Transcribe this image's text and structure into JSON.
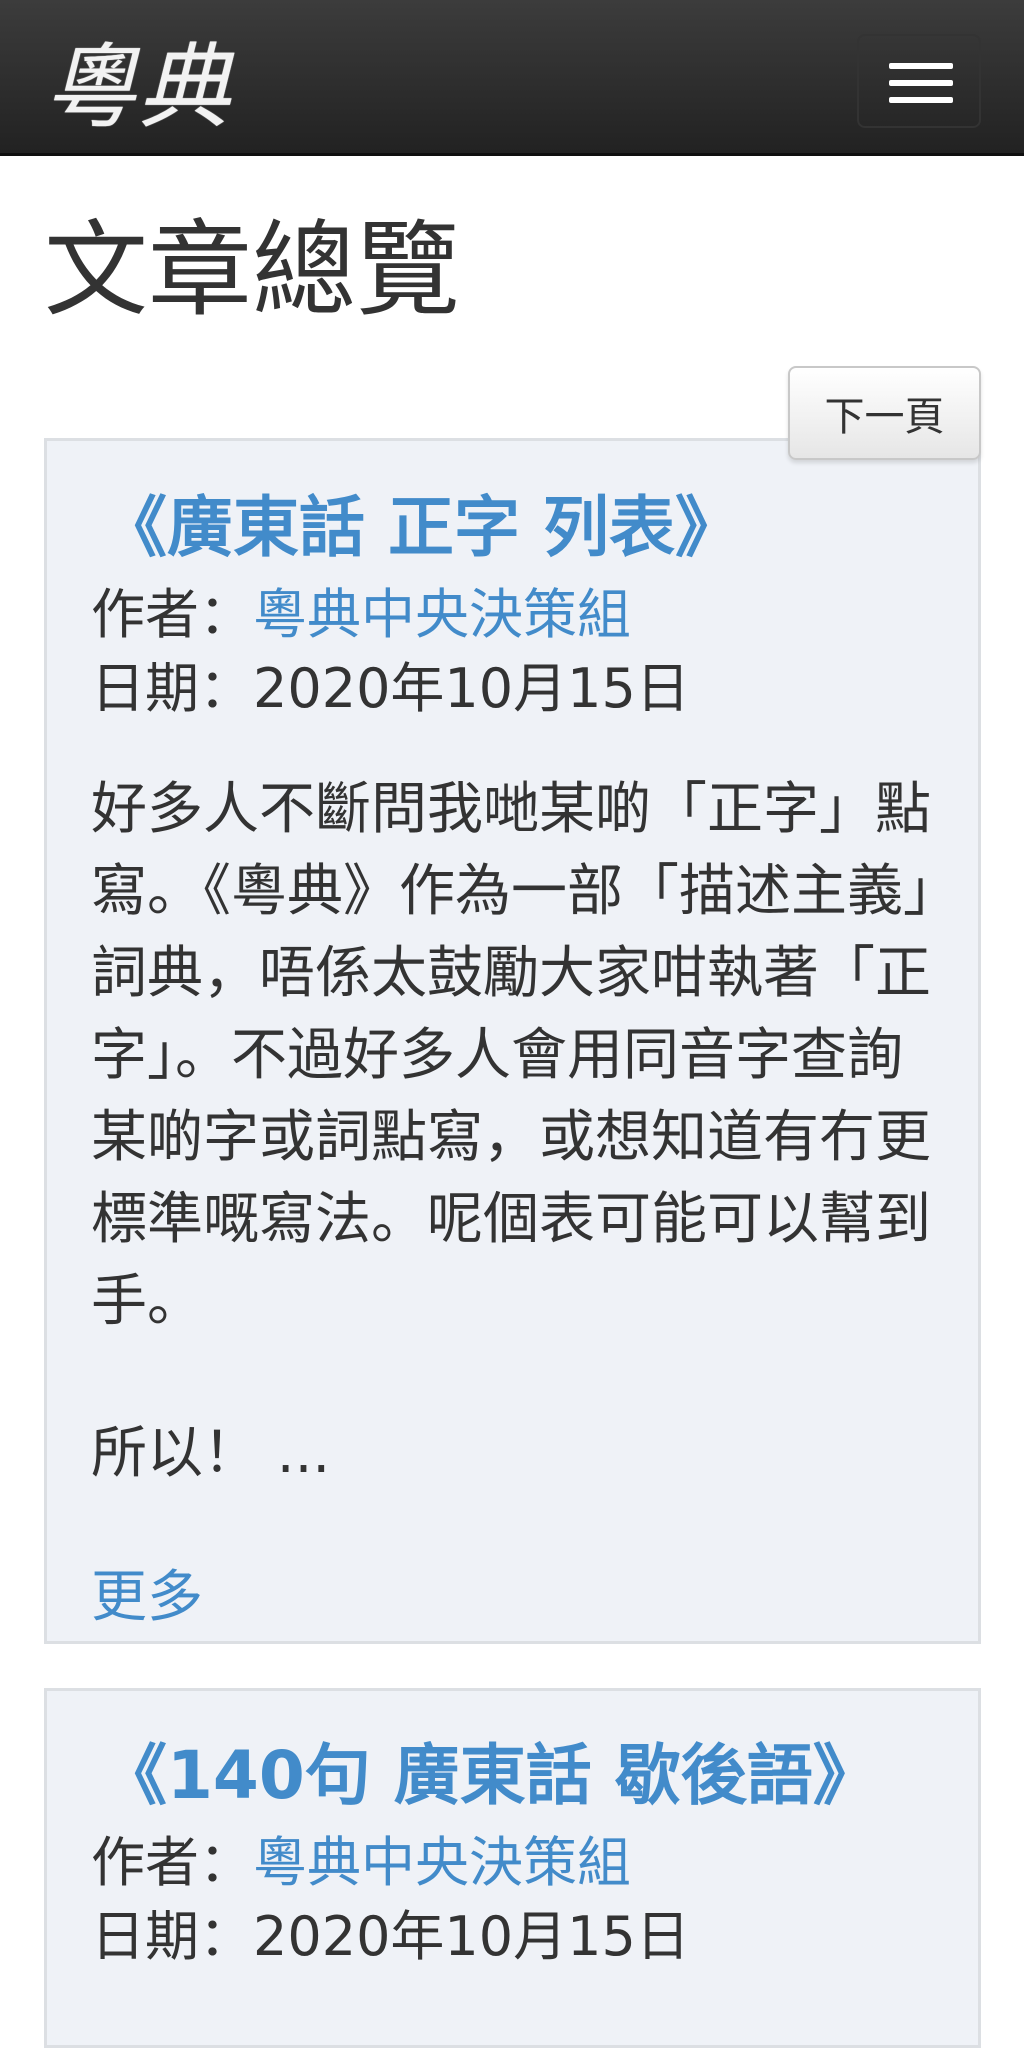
{
  "header": {
    "brand": "粵典",
    "menu_icon": "hamburger-menu-icon"
  },
  "page": {
    "title": "文章總覽"
  },
  "pager": {
    "next_label": "下一頁"
  },
  "articles": [
    {
      "title": "《廣東話 正字 列表》",
      "author_label": "作者：",
      "author": "粵典中央決策組",
      "date_label": "日期：",
      "date": "2020年10月15日",
      "excerpt": "好多人不斷問我哋某啲「正字」點寫。《粵典》作為一部「描述主義」詞典，唔係太鼓勵大家咁執著「正字」。不過好多人會用同音字查詢某啲字或詞點寫，或想知道有冇更標準嘅寫法。呢個表可能可以幫到手。",
      "excerpt_tail": "所以！ ...",
      "more_label": "更多"
    },
    {
      "title": "《140句 廣東話 歇後語》",
      "author_label": "作者：",
      "author": "粵典中央決策組",
      "date_label": "日期：",
      "date": "2020年10月15日"
    }
  ],
  "colors": {
    "link": "#428bca",
    "navbar": "#2b2b2b",
    "card_bg": "#eff2f7"
  }
}
